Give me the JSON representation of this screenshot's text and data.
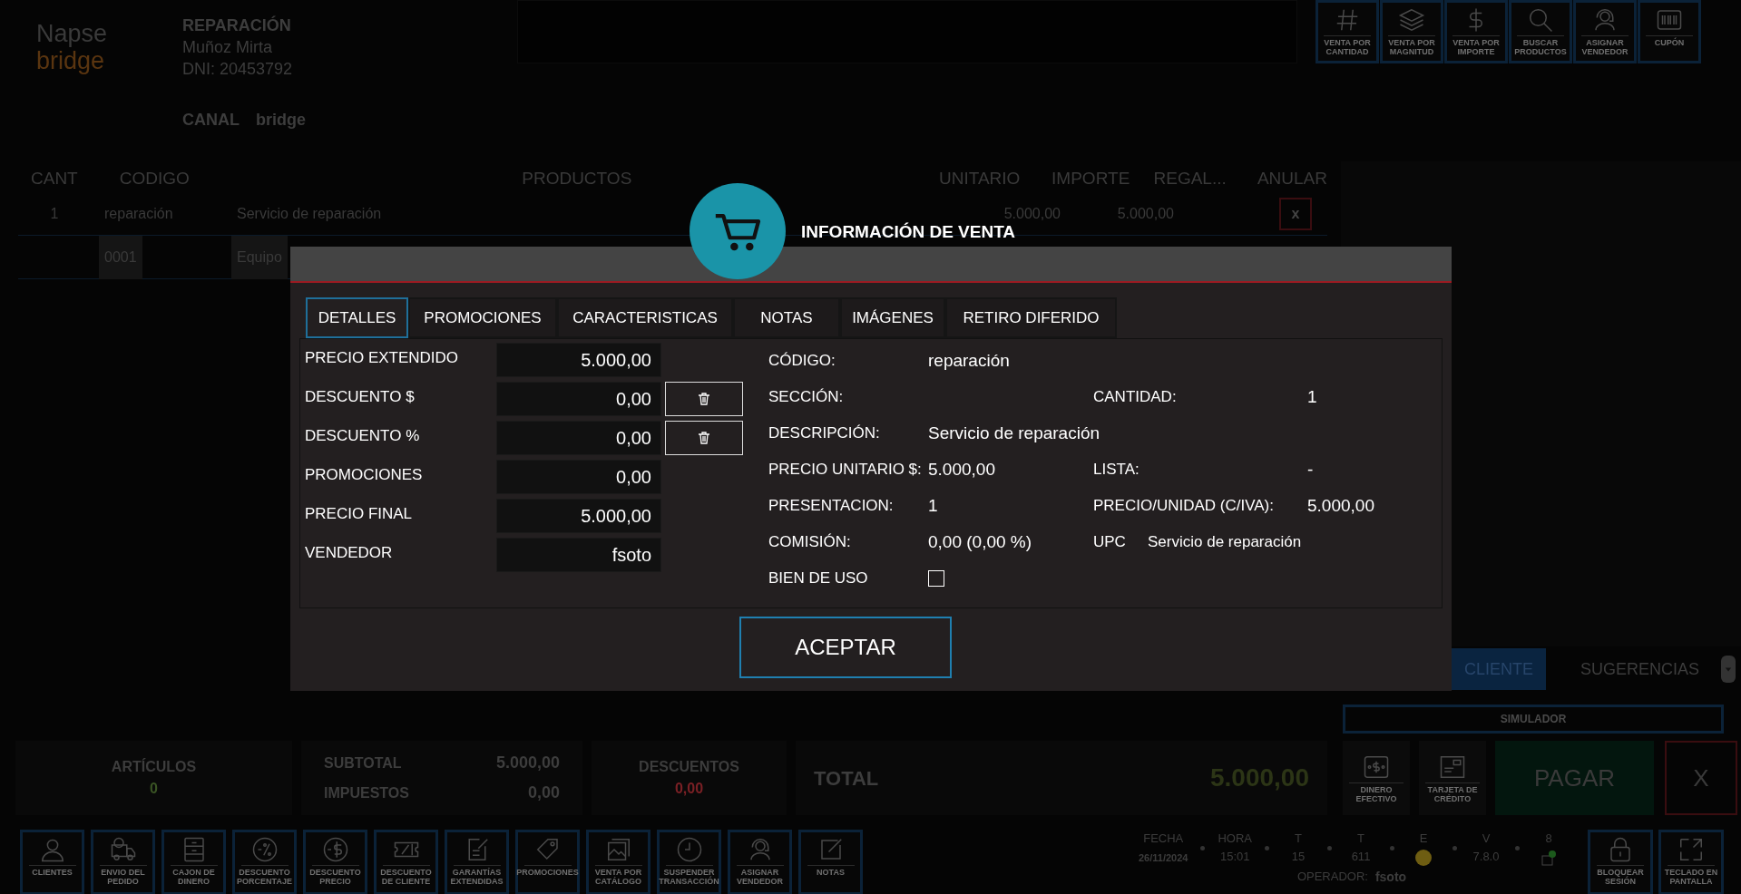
{
  "header": {
    "logo_top": "Napse",
    "logo_bottom": "bridge",
    "title": "REPARACIÓN",
    "customer": "Muñoz Mirta",
    "dni": "DNI: 20453792",
    "canal_label": "CANAL",
    "canal_value": "bridge"
  },
  "top_toolbar": [
    {
      "kind": "hash",
      "label": "VENTA POR CANTIDAD"
    },
    {
      "kind": "layers",
      "label": "VENTA POR MAGNITUD"
    },
    {
      "kind": "dollar",
      "label": "VENTA POR IMPORTE"
    },
    {
      "kind": "search",
      "label": "BUSCAR PRODUCTOS"
    },
    {
      "kind": "headset",
      "label": "ASIGNAR VENDEDOR"
    },
    {
      "kind": "barcode",
      "label": "CUPÓN"
    }
  ],
  "table": {
    "columns": [
      "CANT",
      "CODIGO",
      "PRODUCTOS",
      "UNITARIO",
      "IMPORTE",
      "REGAL...",
      "ANULAR"
    ],
    "rows": [
      {
        "cant": "1",
        "codigo": "reparación",
        "producto": "Servicio de reparación",
        "unitario": "5.000,00",
        "importe": "5.000,00",
        "anular": "x",
        "selected": false
      },
      {
        "codigo": "0001",
        "producto": "Equipo",
        "selected": true
      }
    ]
  },
  "side_tabs": [
    {
      "label": "CLIENTE",
      "selected": true
    },
    {
      "label": "SUGERENCIAS",
      "selected": false
    }
  ],
  "modal": {
    "title": "INFORMACIÓN DE VENTA",
    "tabs": [
      {
        "label": "DETALLES",
        "selected": true
      },
      {
        "label": "PROMOCIONES",
        "selected": false
      },
      {
        "label": "CARACTERISTICAS",
        "selected": false
      },
      {
        "label": "NOTAS",
        "selected": false
      },
      {
        "label": "IMÁGENES",
        "selected": false
      },
      {
        "label": "RETIRO DIFERIDO",
        "selected": false
      }
    ],
    "fields": [
      {
        "label": "PRECIO EXTENDIDO",
        "value": "5.000,00",
        "clearable": false
      },
      {
        "label": "DESCUENTO $",
        "value": "0,00",
        "clearable": true
      },
      {
        "label": "DESCUENTO %",
        "value": "0,00",
        "clearable": true
      },
      {
        "label": "PROMOCIONES",
        "value": "0,00",
        "clearable": false
      },
      {
        "label": "PRECIO FINAL",
        "value": "5.000,00",
        "clearable": false
      },
      {
        "label": "VENDEDOR",
        "value": "fsoto",
        "clearable": false
      }
    ],
    "info": [
      {
        "kind": "text",
        "label": "CÓDIGO:",
        "value": "reparación"
      },
      {
        "kind": "text",
        "label": "SECCIÓN:",
        "label2": "CANTIDAD:",
        "value2": "1"
      },
      {
        "kind": "text",
        "label": "DESCRIPCIÓN:",
        "value": "Servicio de reparación"
      },
      {
        "kind": "text",
        "label": "PRECIO UNITARIO $:",
        "value": "5.000,00",
        "label2": "LISTA:",
        "value2": "-"
      },
      {
        "kind": "text",
        "label": "PRESENTACION:",
        "value": "1",
        "label2": "PRECIO/UNIDAD (C/IVA):",
        "value2": "5.000,00"
      },
      {
        "kind": "inline",
        "label": "COMISIÓN:",
        "value": "0,00 (0,00 %)",
        "label2": "UPC",
        "value2": "Servicio de reparación"
      },
      {
        "kind": "checkbox",
        "label": "BIEN DE USO",
        "checked": false
      }
    ],
    "accept": "ACEPTAR"
  },
  "totals": {
    "articulos_label": "ARTÍCULOS",
    "articulos": "0",
    "subtotal_label": "SUBTOTAL",
    "subtotal": "5.000,00",
    "impuestos_label": "IMPUESTOS",
    "impuestos": "0,00",
    "descuentos_label": "DESCUENTOS",
    "descuentos": "0,00",
    "total_label": "TOTAL",
    "total": "5.000,00"
  },
  "simulator": "SIMULADOR",
  "payments": [
    {
      "kind": "cash",
      "label": "DINERO EFECTIVO"
    },
    {
      "kind": "card",
      "label": "TARJETA DE CRÉDITO"
    }
  ],
  "pay": "PAGAR",
  "cancel": "X",
  "bottom_toolbar": [
    {
      "kind": "person",
      "label": "CLIENTES"
    },
    {
      "kind": "truck",
      "label": "ENVIO DEL PEDIDO"
    },
    {
      "kind": "drawer",
      "label": "CAJON DE DINERO"
    },
    {
      "kind": "percent",
      "label": "DESCUENTO PORCENTAJE"
    },
    {
      "kind": "dollarcircle",
      "label": "DESCUENTO PRECIO"
    },
    {
      "kind": "ticket",
      "label": "DESCUENTO DE CLIENTE"
    },
    {
      "kind": "doc",
      "label": "GARANTÍAS EXTENDIDAS"
    },
    {
      "kind": "tag",
      "label": "PROMOCIONES"
    },
    {
      "kind": "image",
      "label": "VENTA POR CATÁLOGO"
    },
    {
      "kind": "clock",
      "label": "SUSPENDER TRANSACCIÓN"
    },
    {
      "kind": "headset",
      "label": "ASIGNAR VENDEDOR"
    },
    {
      "kind": "note",
      "label": "NOTAS"
    }
  ],
  "status": [
    {
      "kind": "text",
      "label": "FECHA",
      "value": "26/11/2024"
    },
    {
      "kind": "text",
      "label": "HORA",
      "value": "15:01"
    },
    {
      "kind": "text",
      "label": "T",
      "value": "15"
    },
    {
      "kind": "text",
      "label": "T",
      "value": "611"
    },
    {
      "kind": "dot",
      "label": "E",
      "color": "#6e5d12"
    },
    {
      "kind": "text",
      "label": "V",
      "value": "7.8.0"
    },
    {
      "kind": "box",
      "label": "8"
    }
  ],
  "operator_label": "OPERADOR:",
  "operator": "fsoto",
  "session_buttons": [
    {
      "kind": "lock",
      "label": "BLOQUEAR SESIÓN"
    },
    {
      "kind": "expand",
      "label": "TECLADO EN PANTALLA"
    }
  ]
}
